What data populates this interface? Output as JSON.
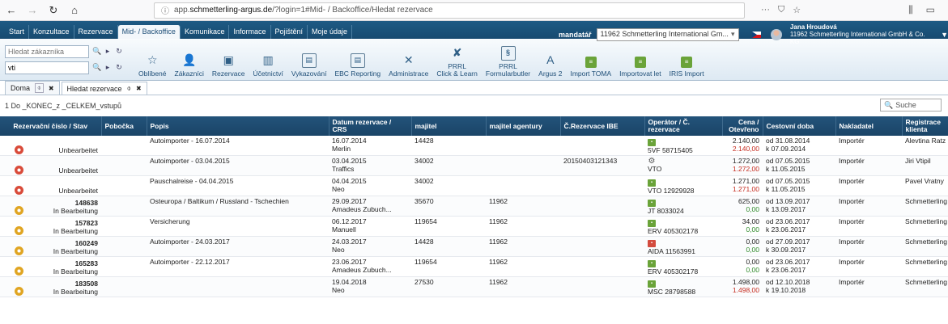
{
  "browser": {
    "url_prefix": "app.",
    "url_host": "schmetterling-argus.de",
    "url_path": "/?login=1#Mid- / Backoffice/Hledat rezervace",
    "menu_icon": "ellipsis-icon",
    "bookmark_icon": "star-icon"
  },
  "main_tabs": [
    "Start",
    "Konzultace",
    "Rezervace",
    "Mid- / Backoffice",
    "Komunikace",
    "Informace",
    "Pojištění",
    "Moje údaje"
  ],
  "active_main_tab": "Mid- / Backoffice",
  "mandator": {
    "label": "mandatář",
    "value": "11962 Schmetterling International Gm..."
  },
  "user": {
    "name": "Jana Hroudová",
    "company": "11962 Schmetterling International GmbH & Co. KG"
  },
  "toolbar": {
    "search_placeholder": "Hledat zákazníka",
    "search2_value": "vti",
    "tools": [
      {
        "label": "Oblíbené",
        "icon": "☆"
      },
      {
        "label": "Zákazníci",
        "icon": "👤"
      },
      {
        "label": "Rezervace",
        "icon": "▣"
      },
      {
        "label": "Účetnictví",
        "icon": "▥"
      },
      {
        "label": "Vykazování",
        "icon": "▤"
      },
      {
        "label": "EBC Reporting",
        "icon": "▤"
      },
      {
        "label": "Administrace",
        "icon": "✕"
      },
      {
        "label": "PRRL\nClick & Learn",
        "icon": "✘"
      },
      {
        "label": "PRRL\nFormularbutler",
        "icon": "§"
      },
      {
        "label": "Argus 2",
        "icon": "A"
      },
      {
        "label": "Import TOMA",
        "icon": "≡"
      },
      {
        "label": "Importovat let",
        "icon": "≡"
      },
      {
        "label": "IRIS Import",
        "icon": "≡"
      }
    ]
  },
  "doc_tabs": [
    {
      "label": "Doma"
    },
    {
      "label": "Hledat rezervace"
    }
  ],
  "result_text": "1 Do _KONEC_z _CELKEM_vstupů",
  "search_placeholder": "Suche",
  "columns": [
    "Rezervační číslo / Stav",
    "Pobočka",
    "Popis",
    "Datum rezervace / CRS",
    "majitel",
    "majitel agentury",
    "Č.Rezervace IBE",
    "Operátor / Č. rezervace",
    "Cena / Otevřeno",
    "Cestovní doba",
    "Nakladatel",
    "Registrace klienta"
  ],
  "rows": [
    {
      "icon": "red",
      "number": "",
      "status": "Unbearbeitet",
      "branch": "",
      "desc": "Autoimporter - 16.07.2014",
      "date": "16.07.2014",
      "crs": "Merlin",
      "owner": "14428",
      "agency_owner": "",
      "ibe": "",
      "op_icon": "green",
      "op_label": "5VF 58715405",
      "price": "2.140,00",
      "open": "2.140,00",
      "open_color": "red",
      "travel_from": "od 31.08.2014",
      "travel_to": "k 07.09.2014",
      "publisher": "Importér",
      "client": "Alevtina Ratz"
    },
    {
      "icon": "red",
      "number": "",
      "status": "Unbearbeitet",
      "branch": "",
      "desc": "Autoimporter - 03.04.2015",
      "date": "03.04.2015",
      "crs": "Traffics",
      "owner": "34002",
      "agency_owner": "",
      "ibe": "20150403121343",
      "op_icon": "gear",
      "op_label": "VTO",
      "price": "1.272,00",
      "open": "1.272,00",
      "open_color": "red",
      "travel_from": "od 07.05.2015",
      "travel_to": "k 11.05.2015",
      "publisher": "Importér",
      "client": "Jiri Vtipil"
    },
    {
      "icon": "red",
      "number": "",
      "status": "Unbearbeitet",
      "branch": "",
      "desc": "Pauschalreise - 04.04.2015",
      "date": "04.04.2015",
      "crs": "Neo",
      "owner": "34002",
      "agency_owner": "",
      "ibe": "",
      "op_icon": "green",
      "op_label": "VTO 12929928",
      "price": "1.271,00",
      "open": "1.271,00",
      "open_color": "red",
      "travel_from": "od 07.05.2015",
      "travel_to": "k 11.05.2015",
      "publisher": "Importér",
      "client": "Pavel Vratny"
    },
    {
      "icon": "yellow",
      "number": "148638",
      "status": "In Bearbeitung",
      "branch": "",
      "desc": "Osteuropa / Baltikum / Russland - Tschechien",
      "date": "29.09.2017",
      "crs": "Amadeus Zubuch...",
      "owner": "35670",
      "agency_owner": "11962",
      "ibe": "",
      "op_icon": "green",
      "op_label": "JT 8033024",
      "price": "625,00",
      "open": "0,00",
      "open_color": "green",
      "travel_from": "od 13.09.2017",
      "travel_to": "k 13.09.2017",
      "publisher": "Importér",
      "client": "Schmetterling Int."
    },
    {
      "icon": "yellow",
      "number": "157823",
      "status": "In Bearbeitung",
      "branch": "",
      "desc": "Versicherung",
      "date": "06.12.2017",
      "crs": "Manuell",
      "owner": "119654",
      "agency_owner": "11962",
      "ibe": "",
      "op_icon": "green",
      "op_label": "ERV 405302178",
      "price": "34,00",
      "open": "0,00",
      "open_color": "green",
      "travel_from": "od 23.06.2017",
      "travel_to": "k 23.06.2017",
      "publisher": "Importér",
      "client": "Schmetterling Int."
    },
    {
      "icon": "yellow",
      "number": "160249",
      "status": "In Bearbeitung",
      "branch": "",
      "desc": "Autoimporter - 24.03.2017",
      "date": "24.03.2017",
      "crs": "Neo",
      "owner": "14428",
      "agency_owner": "11962",
      "ibe": "",
      "op_icon": "red",
      "op_label": "AIDA 11563991",
      "price": "0,00",
      "open": "0,00",
      "open_color": "green",
      "travel_from": "od 27.09.2017",
      "travel_to": "k 30.09.2017",
      "publisher": "Importér",
      "client": "Schmetterling Int."
    },
    {
      "icon": "yellow",
      "number": "165283",
      "status": "In Bearbeitung",
      "branch": "",
      "desc": "Autoimporter - 22.12.2017",
      "date": "23.06.2017",
      "crs": "Amadeus Zubuch...",
      "owner": "119654",
      "agency_owner": "11962",
      "ibe": "",
      "op_icon": "green",
      "op_label": "ERV 405302178",
      "price": "0,00",
      "open": "0,00",
      "open_color": "green",
      "travel_from": "od 23.06.2017",
      "travel_to": "k 23.06.2017",
      "publisher": "Importér",
      "client": "Schmetterling Int."
    },
    {
      "icon": "yellow",
      "number": "183508",
      "status": "In Bearbeitung",
      "branch": "",
      "desc": "",
      "date": "19.04.2018",
      "crs": "Neo",
      "owner": "27530",
      "agency_owner": "11962",
      "ibe": "",
      "op_icon": "green",
      "op_label": "MSC 28798588",
      "price": "1.498,00",
      "open": "1.498,00",
      "open_color": "red",
      "travel_from": "od 12.10.2018",
      "travel_to": "k 19.10.2018",
      "publisher": "Importér",
      "client": "Schmetterling Int."
    }
  ],
  "colors": {
    "header_blue": "#1f4f78",
    "open_red": "#c52b1f",
    "open_green": "#2f8a2a",
    "status_red": "#d94b3a",
    "status_yellow": "#e0a522"
  }
}
